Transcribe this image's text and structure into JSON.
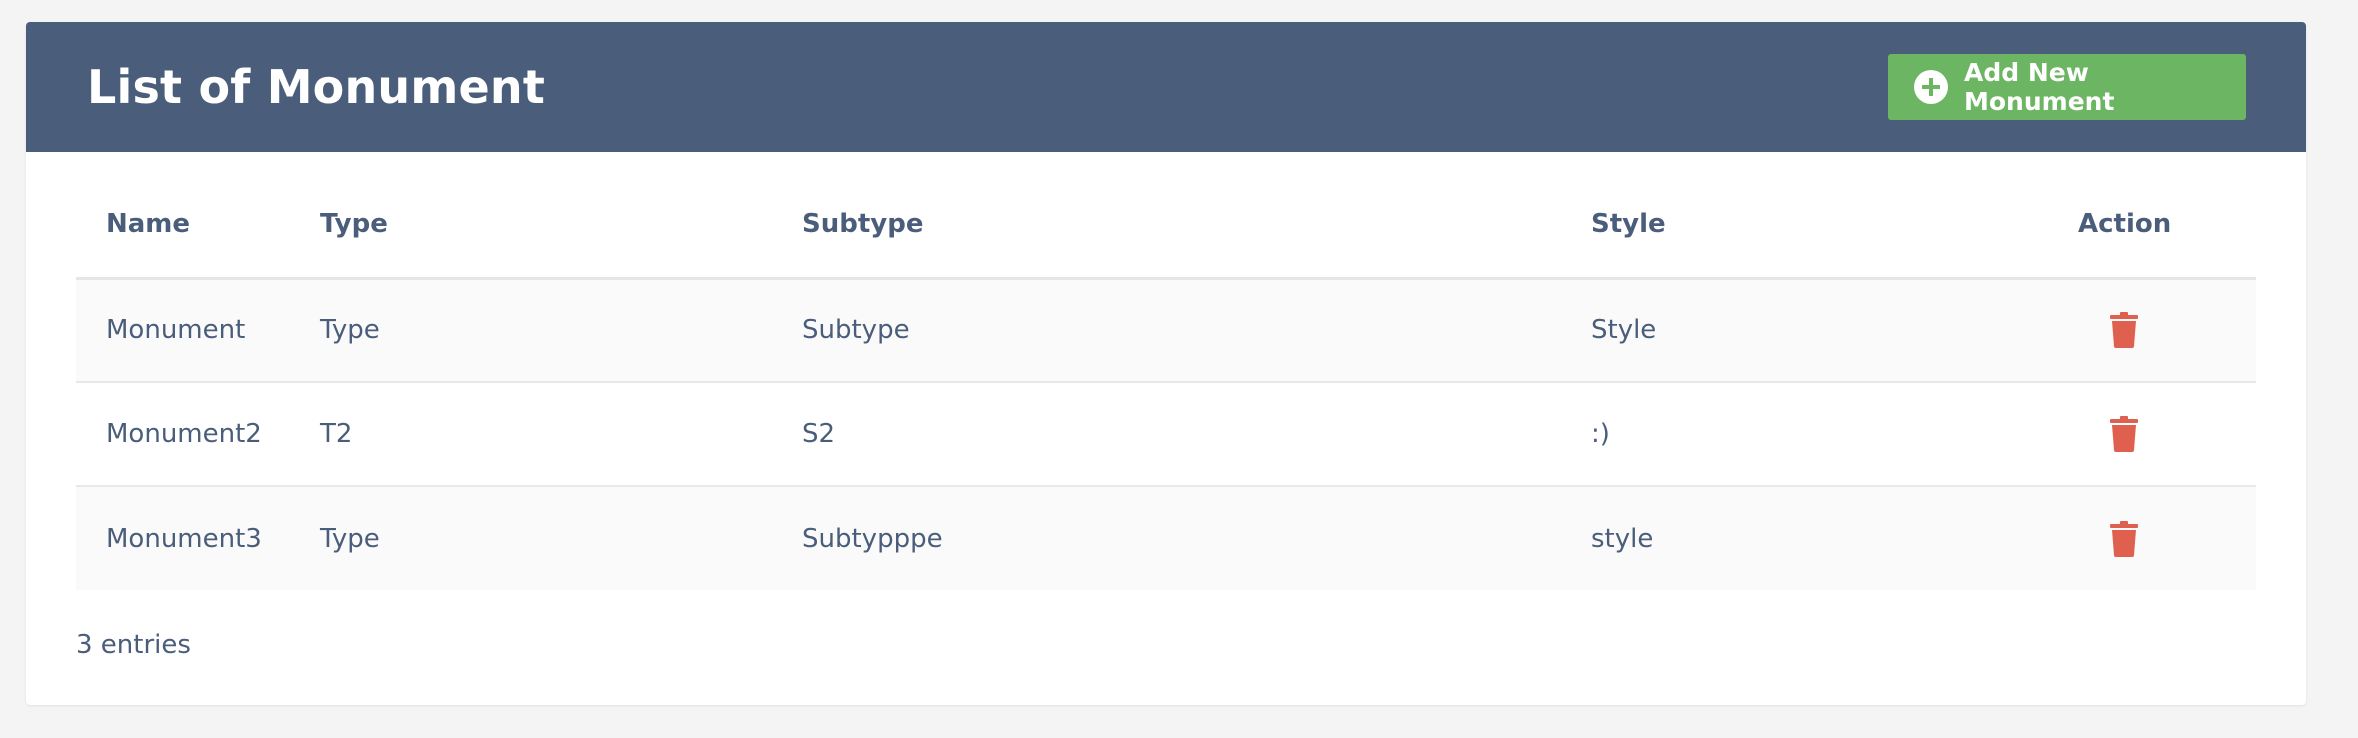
{
  "header": {
    "title": "List of Monument",
    "add_button_label": "Add New Monument"
  },
  "table": {
    "columns": [
      "Name",
      "Type",
      "Subtype",
      "Style",
      "Action"
    ],
    "rows": [
      {
        "name": "Monument",
        "type": "Type",
        "subtype": "Subtype",
        "style": "Style"
      },
      {
        "name": "Monument2",
        "type": "T2",
        "subtype": "S2",
        "style": ":)"
      },
      {
        "name": "Monument3",
        "type": "Type",
        "subtype": "Subtypppe",
        "style": "style"
      }
    ]
  },
  "footer": {
    "entries_text": "3 entries"
  },
  "colors": {
    "header_bg": "#4a5e7b",
    "add_button_bg": "#6cb562",
    "delete_icon": "#e0604f",
    "text": "#4a5e7b"
  },
  "icons": {
    "add": "plus-circle-icon",
    "delete": "trash-icon"
  }
}
